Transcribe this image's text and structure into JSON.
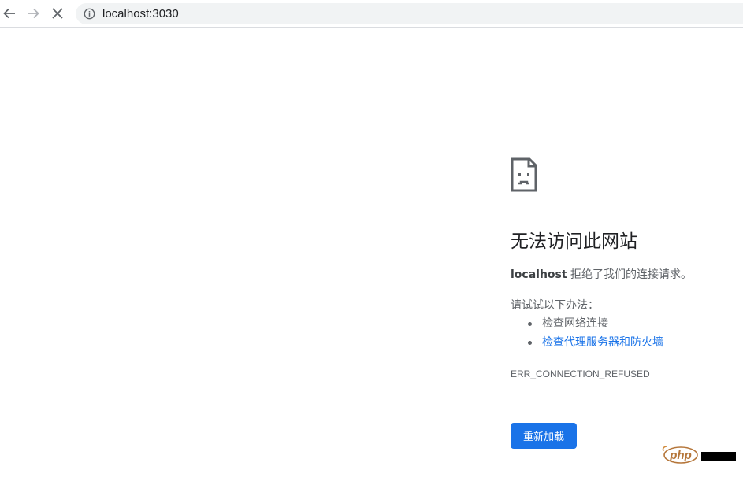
{
  "browser": {
    "url": "localhost:3030",
    "icons": {
      "back": "arrow-left-icon",
      "forward": "arrow-right-icon",
      "stop": "close-icon",
      "site_info": "info-circle-icon"
    }
  },
  "error": {
    "icon": "sad-page-icon",
    "title": "无法访问此网站",
    "summary_host": "localhost",
    "summary_text": " 拒绝了我们的连接请求。",
    "suggestions_heading": "请试试以下办法：",
    "suggestions": [
      {
        "label": "检查网络连接",
        "is_link": false
      },
      {
        "label": "检查代理服务器和防火墙",
        "is_link": true
      }
    ],
    "code": "ERR_CONNECTION_REFUSED",
    "reload_label": "重新加载"
  },
  "watermark": {
    "text": "php",
    "icon": "php-logo"
  },
  "colors": {
    "accent": "#1a73e8",
    "text_primary": "#202124",
    "text_secondary": "#5f6368",
    "omnibox_bg": "#f1f3f4"
  }
}
